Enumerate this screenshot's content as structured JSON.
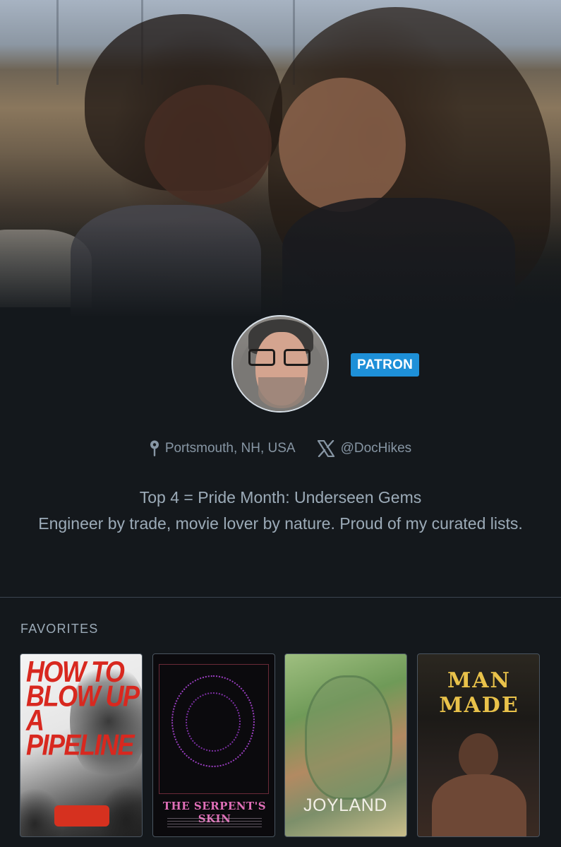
{
  "profile": {
    "badge": "PATRON",
    "location": "Portsmouth, NH, USA",
    "twitter_handle": "@DocHikes",
    "bio_line1": "Top 4 = Pride Month: Underseen Gems",
    "bio_line2": "Engineer by trade, movie lover by nature. Proud of my curated lists."
  },
  "favorites": {
    "heading": "FAVORITES",
    "items": [
      {
        "title_text": "HOW TO BLOW UP A PIPELINE"
      },
      {
        "title_text": "THE SERPENT'S SKIN"
      },
      {
        "title_text": "JOYLAND"
      },
      {
        "title_text": "MAN MADE"
      }
    ]
  },
  "colors": {
    "background": "#14181c",
    "badge": "#1e90d8",
    "text_muted": "#8796a4"
  },
  "icons": {
    "location": "map-pin-icon",
    "twitter": "x-logo-icon"
  }
}
